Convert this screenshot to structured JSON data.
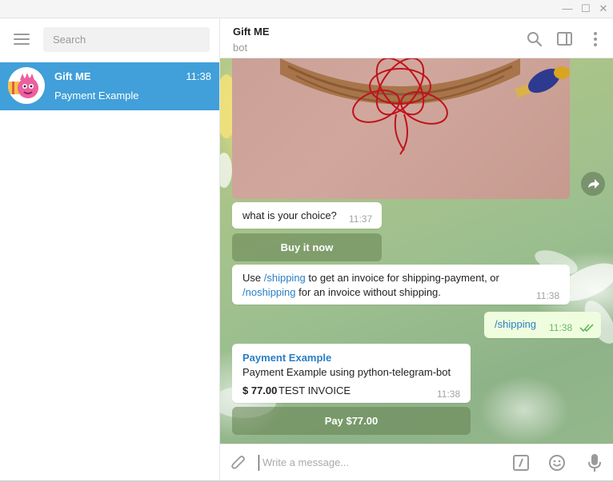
{
  "window": {
    "minimize_icon": "minimize-icon",
    "maximize_icon": "maximize-icon",
    "close_icon": "close-icon"
  },
  "sidebar": {
    "search_placeholder": "Search",
    "chats": [
      {
        "name": "Gift ME",
        "time": "11:38",
        "last_message": "Payment Example",
        "selected": true
      }
    ]
  },
  "header": {
    "title": "Gift ME",
    "subtitle": "bot",
    "icons": [
      "search-icon",
      "side-panel-icon",
      "more-vertical-icon"
    ]
  },
  "messages": {
    "choice_text": "what is your choice?",
    "choice_time": "11:37",
    "buy_button": "Buy it now",
    "info_use": "Use ",
    "info_shipping_cmd": "/shipping",
    "info_mid": " to get an invoice for shipping-payment, or",
    "info_noshipping_cmd": "/noshipping",
    "info_end": " for an invoice without shipping.",
    "info_time": "11:38",
    "outgoing_text": "/shipping",
    "outgoing_time": "11:38",
    "invoice_title": "Payment Example",
    "invoice_desc": "Payment Example using python-telegram-bot",
    "invoice_amount": "$ 77.00",
    "invoice_label": "TEST INVOICE",
    "invoice_time": "11:38",
    "pay_button": "Pay $77.00"
  },
  "composer": {
    "placeholder": "Write a message...",
    "icons": [
      "attach-icon",
      "bot-command-icon",
      "emoji-icon",
      "microphone-icon"
    ]
  },
  "colors": {
    "accent": "#419fd9",
    "link": "#2a7fc4",
    "outgoing_bubble": "#effdde",
    "read_check": "#5fb85f"
  }
}
